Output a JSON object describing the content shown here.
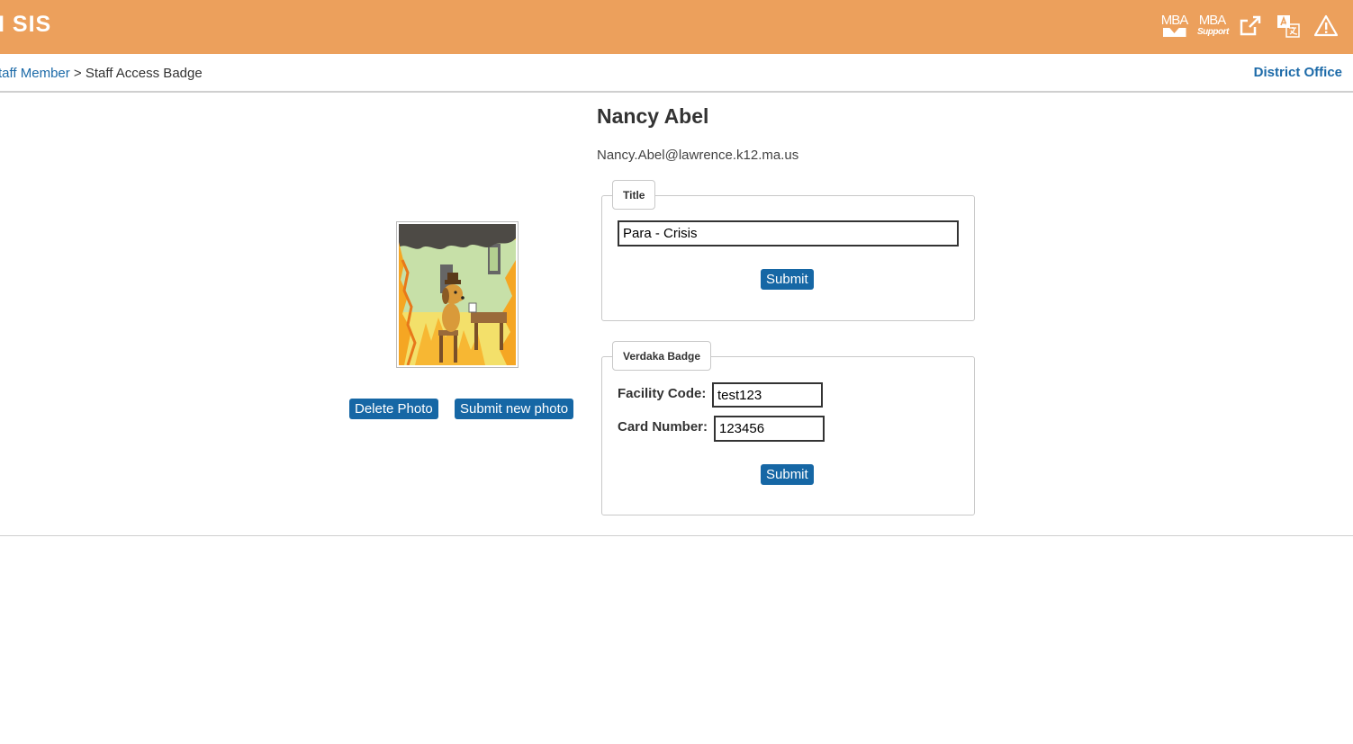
{
  "header": {
    "app_title": "I SIS",
    "icons": [
      {
        "name": "mba-download-icon",
        "line1": "MBA",
        "line2": ""
      },
      {
        "name": "mba-support-icon",
        "line1": "MBA",
        "line2": "Support"
      },
      {
        "name": "external-link-icon"
      },
      {
        "name": "translate-icon"
      },
      {
        "name": "warning-icon"
      }
    ],
    "color": "#eca05c"
  },
  "breadcrumb": {
    "link": "taff Member",
    "separator": " > ",
    "current": "Staff Access Badge",
    "right_label": "District Office"
  },
  "profile": {
    "name": "Nancy Abel",
    "email": "Nancy.Abel@lawrence.k12.ma.us"
  },
  "photo_actions": {
    "delete_label": "Delete Photo",
    "submit_label": "Submit new photo"
  },
  "title_section": {
    "legend": "Title",
    "value": "Para - Crisis",
    "submit_label": "Submit"
  },
  "badge_section": {
    "legend": "Verdaka Badge",
    "facility_label": "Facility Code:",
    "facility_value": "test123",
    "card_label": "Card Number:",
    "card_value": "123456",
    "submit_label": "Submit"
  },
  "colors": {
    "accent": "#1667a5",
    "link": "#1c6aa8",
    "header": "#eca05c"
  }
}
